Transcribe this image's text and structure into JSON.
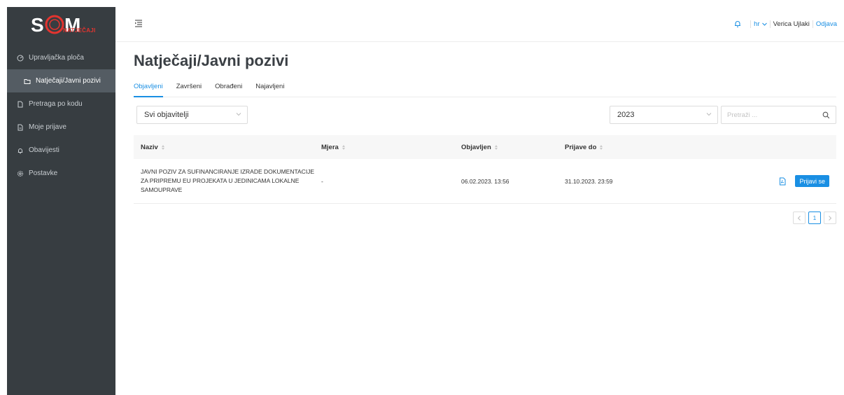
{
  "brand": {
    "logo_text": "SOM",
    "logo_sub": "NATJEČAJI",
    "accent": "#1a8fe3",
    "logo_color": "#e3342f"
  },
  "sidebar": {
    "items": [
      {
        "label": "Upravljačka ploča",
        "icon": "dashboard-icon"
      },
      {
        "label": "Natječaji/Javni pozivi",
        "icon": "folder-icon",
        "active": true
      },
      {
        "label": "Pretraga po kodu",
        "icon": "document-icon"
      },
      {
        "label": "Moje prijave",
        "icon": "document-edit-icon"
      },
      {
        "label": "Obavijesti",
        "icon": "bell-icon"
      },
      {
        "label": "Postavke",
        "icon": "gear-icon"
      }
    ]
  },
  "header": {
    "language": "hr",
    "user_name": "Verica Ujlaki",
    "logout_label": "Odjava"
  },
  "page": {
    "title": "Natječaji/Javni pozivi",
    "tabs": [
      {
        "label": "Objavljeni",
        "active": true
      },
      {
        "label": "Završeni"
      },
      {
        "label": "Obrađeni"
      },
      {
        "label": "Najavljeni"
      }
    ]
  },
  "filters": {
    "publisher": "Svi objavitelji",
    "year": "2023",
    "search_placeholder": "Pretraži ..."
  },
  "table": {
    "columns": [
      "Naziv",
      "Mjera",
      "Objavljen",
      "Prijave do"
    ],
    "rows": [
      {
        "naziv": "JAVNI POZIV ZA SUFINANCIRANJE IZRADE DOKUMENTACIJE ZA PRIPREMU EU PROJEKATA U JEDINICAMA LOKALNE SAMOUPRAVE",
        "mjera": "-",
        "objavljen": "06.02.2023. 13:56",
        "prijave_do": "31.10.2023. 23:59",
        "action_label": "Prijavi se"
      }
    ]
  },
  "pagination": {
    "current": "1"
  }
}
